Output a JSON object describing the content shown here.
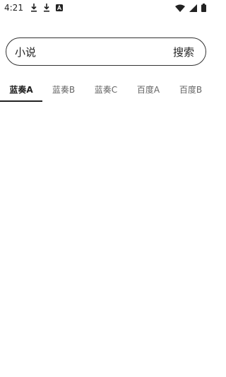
{
  "status_bar": {
    "time": "4:21",
    "left_icons": [
      "download-icon",
      "download-icon",
      "app-a-icon"
    ],
    "right_icons": [
      "wifi-icon",
      "signal-icon",
      "battery-icon"
    ]
  },
  "search": {
    "value": "小说",
    "placeholder": "",
    "button_label": "搜索"
  },
  "tabs": [
    {
      "label": "蓝奏A",
      "active": true
    },
    {
      "label": "蓝奏B",
      "active": false
    },
    {
      "label": "蓝奏C",
      "active": false
    },
    {
      "label": "百度A",
      "active": false
    },
    {
      "label": "百度B",
      "active": false
    }
  ],
  "colors": {
    "text_primary": "#222222",
    "text_secondary": "#666666",
    "border": "#333333",
    "background": "#ffffff"
  }
}
